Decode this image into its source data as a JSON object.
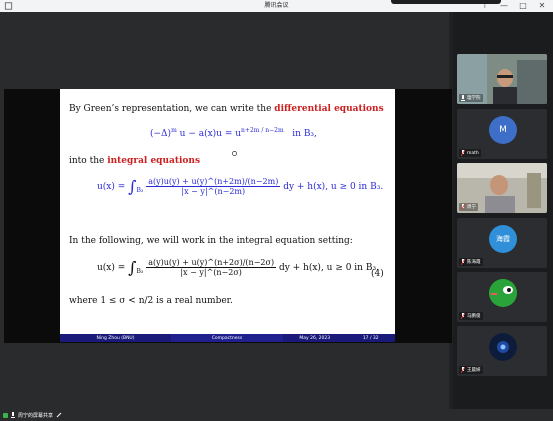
{
  "window": {
    "title": "腾讯会议"
  },
  "controls": {
    "pin_icon": "pin-icon",
    "minimize": "—",
    "maximize": "□",
    "close": "✕"
  },
  "slide": {
    "line1_prefix": "By Green’s representation, we can write the",
    "line1_highlight": "differential equations",
    "eq1_left": "(−Δ)",
    "eq1_left_sup": "m",
    "eq1_mid": "u − a(x)u = u",
    "eq1_sup": "n+2m / n−2m",
    "eq1_domain": "in B₃,",
    "line2_prefix": "into the",
    "line2_highlight": "integral equations",
    "eq2_lhs": "u(x) =",
    "eq2_sub": "B₃",
    "eq2_num": "a(y)u(y) + u(y)^(n+2m)/(n−2m)",
    "eq2_den": "|x − y|^(n−2m)",
    "eq2_rhs": "dy + h(x),   u ≥ 0   in  B₃.",
    "line3": "In the following, we will work in the integral equation setting:",
    "eq3_lhs": "u(x) =",
    "eq3_sub": "B₃",
    "eq3_num": "a(y)u(y) + u(y)^(n+2σ)/(n−2σ)",
    "eq3_den": "|x − y|^(n−2σ)",
    "eq3_rhs": "dy + h(x),   u ≥ 0   in  B₃.",
    "eq3_number": "(4)",
    "line4": "where 1 ≤ σ < n/2 is a real number.",
    "footer_author": "Ning Zhou  (BNU)",
    "footer_title": "Compactness",
    "footer_date": "May 26, 2023",
    "footer_page": "17 / 32"
  },
  "participants": [
    {
      "name": "理学院",
      "type": "video",
      "muted": false
    },
    {
      "name": "math",
      "type": "avatar",
      "avatar_text": "M",
      "color": "#3d6fc8",
      "muted": true
    },
    {
      "name": "周宁",
      "type": "video",
      "muted": true
    },
    {
      "name": "陈海霞",
      "type": "avatar",
      "avatar_text": "海霞",
      "color": "#2f8fd8",
      "muted": true
    },
    {
      "name": "马鹏俊",
      "type": "avatar",
      "avatar_text": "",
      "color": "#2aa33a",
      "muted": true
    },
    {
      "name": "王晨妍",
      "type": "avatar",
      "avatar_text": "",
      "color": "#0d1c3a",
      "muted": true
    }
  ],
  "bottom_bar": {
    "share_status": "周宁的屏幕共享"
  }
}
